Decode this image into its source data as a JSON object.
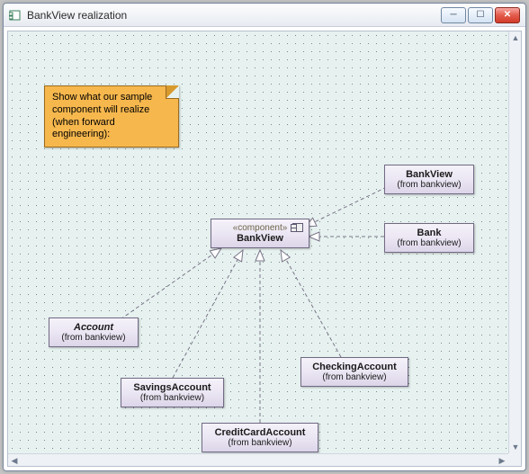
{
  "window": {
    "title": "BankView realization",
    "icon": "diagram-icon",
    "buttons": {
      "min": "─",
      "max": "☐",
      "close": "✕"
    }
  },
  "note": {
    "line1": "Show what our sample",
    "line2": "component will realize",
    "line3": "(when forward",
    "line4": "engineering):"
  },
  "component": {
    "stereotype": "«component»",
    "name": "BankView"
  },
  "boxes": {
    "bankview_class": {
      "name": "BankView",
      "from": "(from bankview)"
    },
    "bank": {
      "name": "Bank",
      "from": "(from bankview)"
    },
    "account": {
      "name": "Account",
      "from": "(from bankview)"
    },
    "savings": {
      "name": "SavingsAccount",
      "from": "(from bankview)"
    },
    "checking": {
      "name": "CheckingAccount",
      "from": "(from bankview)"
    },
    "creditcard": {
      "name": "CreditCardAccount",
      "from": "(from bankview)"
    }
  },
  "edges": [
    {
      "from": "bankview_class",
      "to": "component"
    },
    {
      "from": "bank",
      "to": "component"
    },
    {
      "from": "account",
      "to": "component"
    },
    {
      "from": "savings",
      "to": "component"
    },
    {
      "from": "checking",
      "to": "component"
    },
    {
      "from": "creditcard",
      "to": "component"
    }
  ]
}
